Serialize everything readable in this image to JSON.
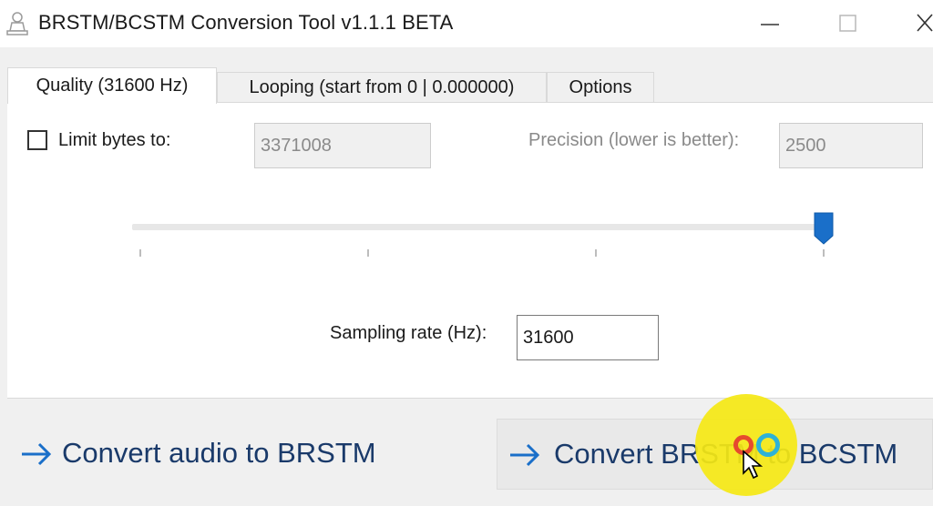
{
  "window": {
    "title": "BRSTM/BCSTM Conversion Tool v1.1.1 BETA",
    "icon": "app-person-icon"
  },
  "tabs": [
    {
      "label": "Quality (31600 Hz)",
      "selected": true
    },
    {
      "label": "Looping (start from 0 | 0.000000)",
      "selected": false
    },
    {
      "label": "Options",
      "selected": false
    }
  ],
  "quality": {
    "limit_bytes_label": "Limit bytes to:",
    "limit_bytes_checked": false,
    "limit_bytes_value": "3371008",
    "precision_label": "Precision (lower is better):",
    "precision_value": "2500",
    "slider_level": 1.0,
    "sampling_label": "Sampling rate (Hz):",
    "sampling_value": "31600"
  },
  "buttons": {
    "convert_audio": "Convert audio to BRSTM",
    "convert_brstm": "Convert BRSTM to BCSTM",
    "arrow_icon": "right-arrow-icon"
  },
  "colors": {
    "accent": "#1a6fc9",
    "button_text": "#1a3a6a",
    "cursor_highlight": "#f5e814"
  }
}
